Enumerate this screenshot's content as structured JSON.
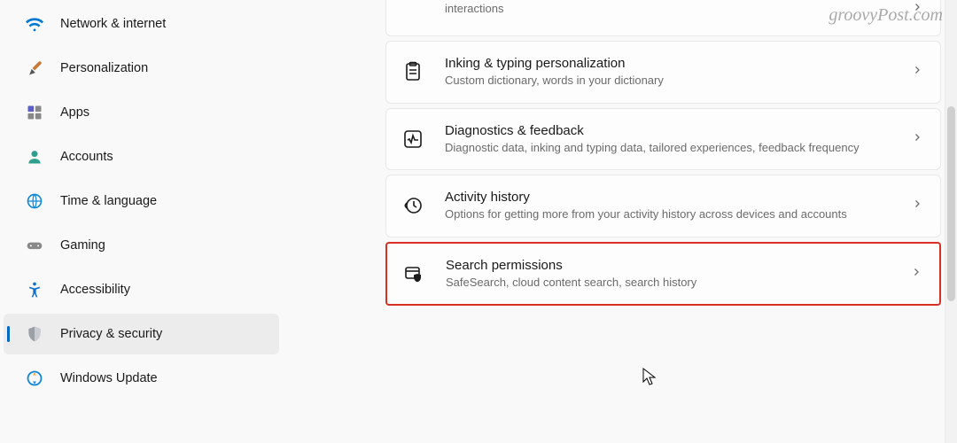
{
  "watermark": "groovyPost.com",
  "sidebar": {
    "items": [
      {
        "label": "Network & internet",
        "icon": "wifi-icon"
      },
      {
        "label": "Personalization",
        "icon": "paintbrush-icon"
      },
      {
        "label": "Apps",
        "icon": "apps-icon"
      },
      {
        "label": "Accounts",
        "icon": "person-icon"
      },
      {
        "label": "Time & language",
        "icon": "globe-clock-icon"
      },
      {
        "label": "Gaming",
        "icon": "gamepad-icon"
      },
      {
        "label": "Accessibility",
        "icon": "accessibility-icon"
      },
      {
        "label": "Privacy & security",
        "icon": "shield-icon",
        "active": true
      },
      {
        "label": "Windows Update",
        "icon": "update-icon"
      }
    ]
  },
  "main": {
    "cards": [
      {
        "title": "",
        "sub": "interactions",
        "icon": "",
        "partial": true
      },
      {
        "title": "Inking & typing personalization",
        "sub": "Custom dictionary, words in your dictionary",
        "icon": "clipboard-icon"
      },
      {
        "title": "Diagnostics & feedback",
        "sub": "Diagnostic data, inking and typing data, tailored experiences, feedback frequency",
        "icon": "activity-icon"
      },
      {
        "title": "Activity history",
        "sub": "Options for getting more from your activity history across devices and accounts",
        "icon": "history-icon"
      },
      {
        "title": "Search permissions",
        "sub": "SafeSearch, cloud content search, search history",
        "icon": "search-shield-icon",
        "highlighted": true
      }
    ]
  }
}
